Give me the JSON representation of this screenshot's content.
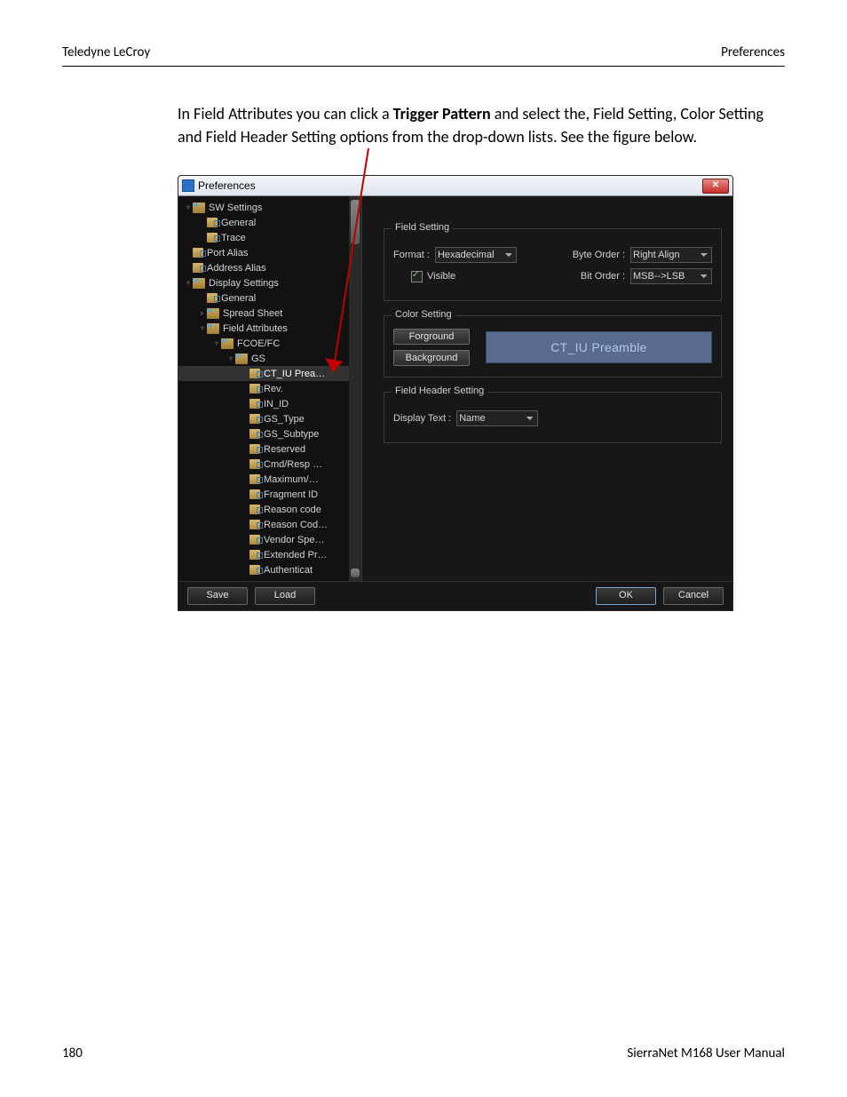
{
  "page": {
    "header_left": "Teledyne LeCroy",
    "header_right": "Preferences",
    "body_pre": "In Field Attributes you can click a ",
    "body_bold": "Trigger Pattern",
    "body_post": " and select the, Field Setting, Color Setting and Field Header Setting options from the drop-down lists. See the figure below.",
    "footer_page": "180",
    "footer_manual": "SierraNet M168 User Manual"
  },
  "dialog": {
    "title": "Preferences",
    "close": "✕",
    "tree": {
      "items": [
        {
          "indent": 0,
          "exp": "▿",
          "icon": "folder",
          "label": "SW Settings"
        },
        {
          "indent": 1,
          "exp": "",
          "icon": "doc",
          "label": "General"
        },
        {
          "indent": 1,
          "exp": "",
          "icon": "doc",
          "label": "Trace"
        },
        {
          "indent": 0,
          "exp": "",
          "icon": "doc",
          "label": "Port Alias"
        },
        {
          "indent": 0,
          "exp": "",
          "icon": "doc",
          "label": "Address Alias"
        },
        {
          "indent": 0,
          "exp": "▿",
          "icon": "folder",
          "label": "Display Settings"
        },
        {
          "indent": 1,
          "exp": "",
          "icon": "doc",
          "label": "General"
        },
        {
          "indent": 1,
          "exp": "▹",
          "icon": "folder",
          "label": "Spread Sheet"
        },
        {
          "indent": 1,
          "exp": "▿",
          "icon": "folder",
          "label": "Field Attributes"
        },
        {
          "indent": 2,
          "exp": "▿",
          "icon": "folder",
          "label": "FCOE/FC"
        },
        {
          "indent": 3,
          "exp": "▿",
          "icon": "folder",
          "label": "GS"
        },
        {
          "indent": 4,
          "exp": "",
          "icon": "doc",
          "label": "CT_IU Prea…",
          "selected": true
        },
        {
          "indent": 4,
          "exp": "",
          "icon": "doc",
          "label": "Rev."
        },
        {
          "indent": 4,
          "exp": "",
          "icon": "doc",
          "label": "IN_ID"
        },
        {
          "indent": 4,
          "exp": "",
          "icon": "doc",
          "label": "GS_Type"
        },
        {
          "indent": 4,
          "exp": "",
          "icon": "doc",
          "label": "GS_Subtype"
        },
        {
          "indent": 4,
          "exp": "",
          "icon": "doc",
          "label": "Reserved"
        },
        {
          "indent": 4,
          "exp": "",
          "icon": "doc",
          "label": "Cmd/Resp …"
        },
        {
          "indent": 4,
          "exp": "",
          "icon": "doc",
          "label": "Maximum/…"
        },
        {
          "indent": 4,
          "exp": "",
          "icon": "doc",
          "label": "Fragment ID"
        },
        {
          "indent": 4,
          "exp": "",
          "icon": "doc",
          "label": "Reason code"
        },
        {
          "indent": 4,
          "exp": "",
          "icon": "doc",
          "label": "Reason Cod…"
        },
        {
          "indent": 4,
          "exp": "",
          "icon": "doc",
          "label": "Vendor Spe…"
        },
        {
          "indent": 4,
          "exp": "",
          "icon": "doc",
          "label": "Extended Pr…"
        },
        {
          "indent": 4,
          "exp": "",
          "icon": "doc",
          "label": "Authenticat"
        }
      ]
    },
    "field_setting": {
      "title": "Field Setting",
      "format_label": "Format :",
      "format_value": "Hexadecimal",
      "byte_order_label": "Byte Order :",
      "byte_order_value": "Right Align",
      "visible_label": "Visible",
      "bit_order_label": "Bit Order :",
      "bit_order_value": "MSB-->LSB"
    },
    "color_setting": {
      "title": "Color Setting",
      "forground": "Forground",
      "background": "Background",
      "preview_text": "CT_IU Preamble"
    },
    "header_setting": {
      "title": "Field Header Setting",
      "display_text_label": "Display Text :",
      "display_text_value": "Name"
    },
    "buttons": {
      "save": "Save",
      "load": "Load",
      "ok": "OK",
      "cancel": "Cancel"
    }
  }
}
